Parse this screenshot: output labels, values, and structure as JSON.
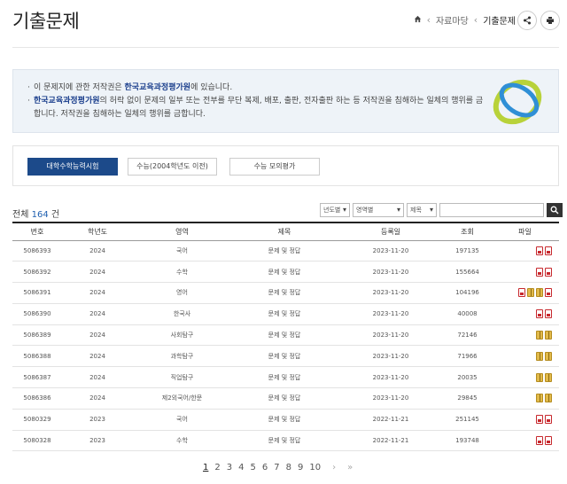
{
  "header": {
    "title": "기출문제",
    "breadcrumb": [
      "자료마당",
      "기출문제"
    ]
  },
  "notice": {
    "line1_pre": "이 문제지에 관한 저작권은 ",
    "line1_org": "한국교육과정평가원",
    "line1_post": "에 있습니다.",
    "line2_org": "한국교육과정평가원",
    "line2_post": "의 허락 없이 문제의 일부 또는 전부를 무단 복제, 배포, 출판, 전자출판 하는 등 저작권을 침해하는 일체의 행위를 금합니다. 저작권을 침해하는 일체의 행위를 금합니다."
  },
  "tabs": [
    {
      "label": "대학수학능력시험",
      "active": true
    },
    {
      "label": "수능(2004학년도 이전)",
      "active": false
    },
    {
      "label": "수능 모의평가",
      "active": false
    }
  ],
  "listing": {
    "total_prefix": "전체",
    "total_count": "164",
    "total_suffix": "건"
  },
  "filters": {
    "year": "년도별",
    "area": "영역별",
    "field": "제목"
  },
  "table": {
    "columns": [
      "번호",
      "학년도",
      "영역",
      "제목",
      "등록일",
      "조회",
      "파일"
    ],
    "rows": [
      {
        "no": "5086393",
        "year": "2024",
        "area": "국어",
        "title": "문제 및 정답",
        "date": "2023-11-20",
        "views": "197135",
        "files": [
          "pdf",
          "pdf"
        ]
      },
      {
        "no": "5086392",
        "year": "2024",
        "area": "수학",
        "title": "문제 및 정답",
        "date": "2023-11-20",
        "views": "155664",
        "files": [
          "pdf",
          "pdf"
        ]
      },
      {
        "no": "5086391",
        "year": "2024",
        "area": "영어",
        "title": "문제 및 정답",
        "date": "2023-11-20",
        "views": "104196",
        "files": [
          "pdf",
          "zip",
          "zip",
          "pdf"
        ]
      },
      {
        "no": "5086390",
        "year": "2024",
        "area": "한국사",
        "title": "문제 및 정답",
        "date": "2023-11-20",
        "views": "40008",
        "files": [
          "pdf",
          "pdf"
        ]
      },
      {
        "no": "5086389",
        "year": "2024",
        "area": "사회탐구",
        "title": "문제 및 정답",
        "date": "2023-11-20",
        "views": "72146",
        "files": [
          "zip",
          "zip"
        ]
      },
      {
        "no": "5086388",
        "year": "2024",
        "area": "과학탐구",
        "title": "문제 및 정답",
        "date": "2023-11-20",
        "views": "71966",
        "files": [
          "zip",
          "zip"
        ]
      },
      {
        "no": "5086387",
        "year": "2024",
        "area": "직업탐구",
        "title": "문제 및 정답",
        "date": "2023-11-20",
        "views": "20035",
        "files": [
          "zip",
          "zip"
        ]
      },
      {
        "no": "5086386",
        "year": "2024",
        "area": "제2외국어/한문",
        "title": "문제 및 정답",
        "date": "2023-11-20",
        "views": "29845",
        "files": [
          "zip",
          "zip"
        ]
      },
      {
        "no": "5080329",
        "year": "2023",
        "area": "국어",
        "title": "문제 및 정답",
        "date": "2022-11-21",
        "views": "251145",
        "files": [
          "pdf",
          "pdf"
        ]
      },
      {
        "no": "5080328",
        "year": "2023",
        "area": "수학",
        "title": "문제 및 정답",
        "date": "2022-11-21",
        "views": "193748",
        "files": [
          "pdf",
          "pdf"
        ]
      }
    ]
  },
  "pagination": {
    "pages": [
      "1",
      "2",
      "3",
      "4",
      "5",
      "6",
      "7",
      "8",
      "9",
      "10"
    ],
    "current": "1",
    "next": "›",
    "last": "»"
  },
  "colors": {
    "accent": "#1c4a8a",
    "link": "#1f5fb0",
    "notice_bg": "#eef3f8"
  }
}
